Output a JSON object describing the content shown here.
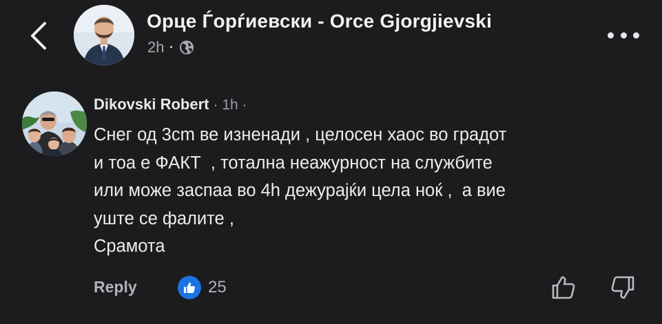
{
  "post": {
    "author": "Орце Ѓорѓиевски - Orce Gjorgjievski",
    "time": "2h",
    "separator": "·",
    "visibility_icon": "globe-icon",
    "more_icon": "more-horizontal-icon",
    "back_icon": "chevron-left-icon"
  },
  "comment": {
    "author": "Dikovski Robert",
    "time": "· 1h ·",
    "lines": [
      "Снег од 3cm ве изненади , целосен хаос во градот",
      "и тоа е ФАКТ  , тотална неажурност на службите",
      "или може заспаа во 4h дежурајќи цела ноќ ,  а вие",
      "уште се фалите ,",
      "Срамота"
    ],
    "reply_label": "Reply",
    "reaction_count": "25",
    "reaction_icon": "like-icon",
    "upvote_icon": "thumbs-up-outline-icon",
    "downvote_icon": "thumbs-down-outline-icon"
  },
  "colors": {
    "background": "#1c1c1e",
    "text_primary": "#e4e6eb",
    "text_secondary": "#b0b3b8",
    "like_blue": "#1b74e4"
  }
}
